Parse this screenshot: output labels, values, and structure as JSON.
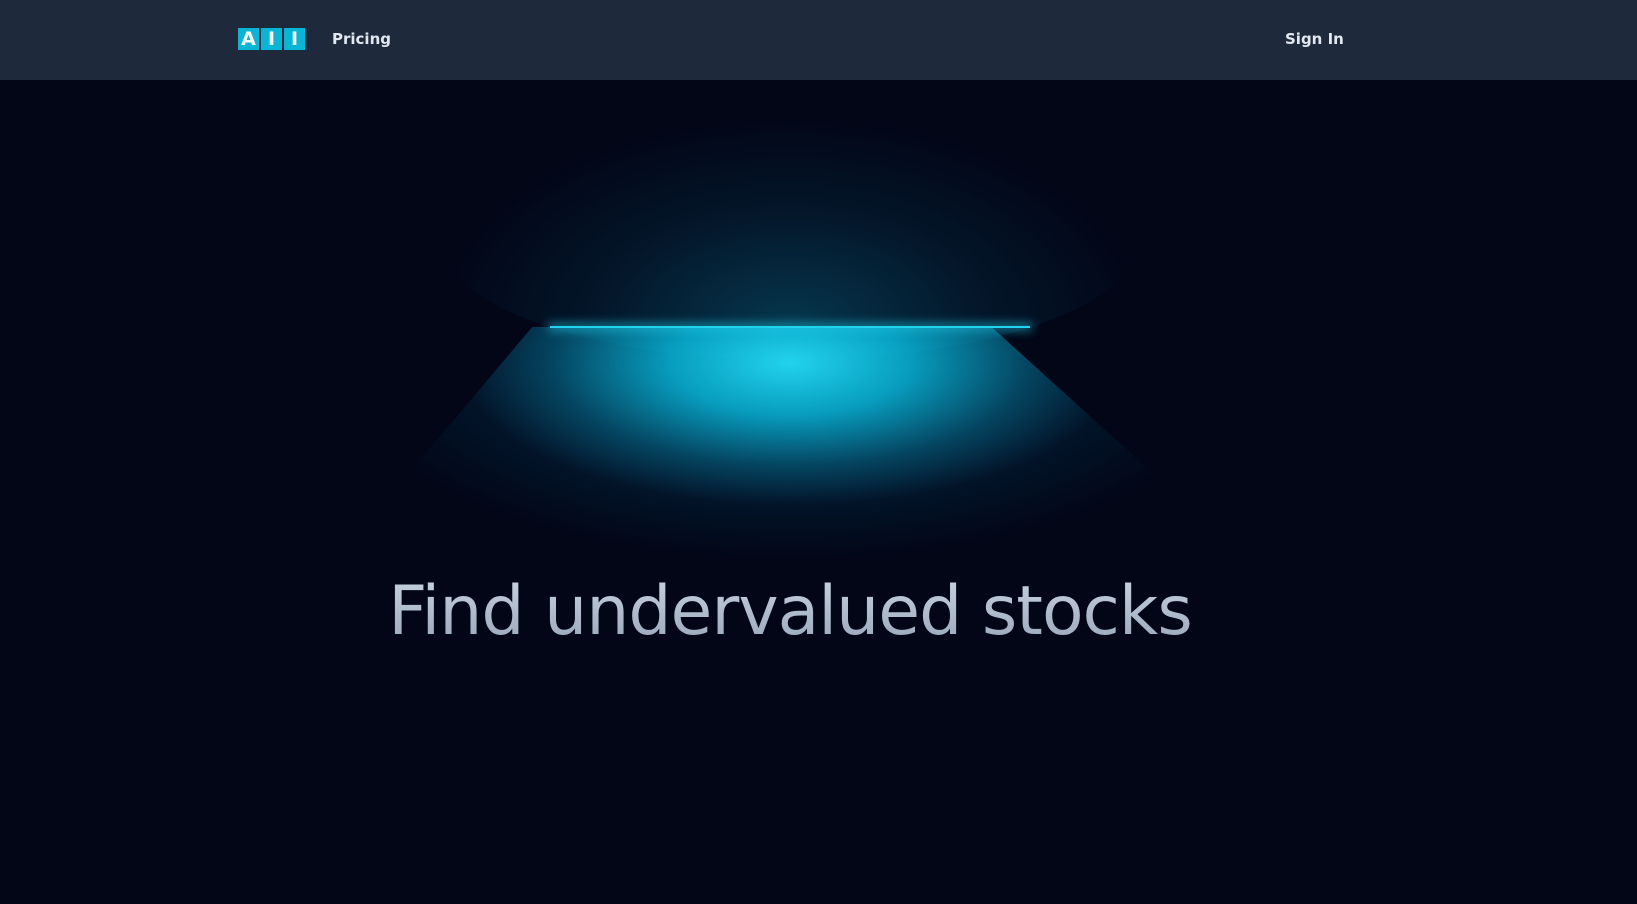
{
  "nav": {
    "logo_letters": [
      "A",
      "I",
      "I"
    ],
    "pricing_label": "Pricing",
    "signin_label": "Sign In"
  },
  "hero": {
    "title": "Find undervalued stocks"
  },
  "colors": {
    "nav_background": "#1e293b",
    "page_background": "#020617",
    "accent": "#22d3ee",
    "logo_block": "#06b6d4",
    "title_text": "#94a3b8"
  }
}
